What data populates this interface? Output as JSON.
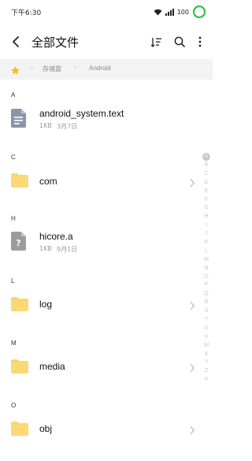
{
  "status_bar": {
    "time": "下午6:30",
    "battery": "100",
    "icons": [
      "wifi-icon",
      "signal-icon",
      "battery-ring-icon"
    ]
  },
  "app_bar": {
    "title": "全部文件",
    "actions": [
      "sort-icon",
      "search-icon",
      "more-vertical-icon"
    ]
  },
  "breadcrumb": {
    "items": [
      "存储盘",
      "Android"
    ]
  },
  "colors": {
    "accent": "#f5b91e",
    "folder": "#fbd46b",
    "file_icon": "#8a96a8",
    "unknown_icon": "#9c9c9c",
    "battery_ring": "#30c24a"
  },
  "sections": [
    {
      "letter": "A",
      "items": [
        {
          "name": "android_system.text",
          "size": "1KB",
          "date": "3月7日",
          "type": "document"
        }
      ]
    },
    {
      "letter": "C",
      "items": [
        {
          "name": "com",
          "type": "folder"
        }
      ]
    },
    {
      "letter": "H",
      "items": [
        {
          "name": "hicore.a",
          "size": "1KB",
          "date": "9月1日",
          "type": "unknown"
        }
      ]
    },
    {
      "letter": "L",
      "items": [
        {
          "name": "log",
          "type": "folder"
        }
      ]
    },
    {
      "letter": "M",
      "items": [
        {
          "name": "media",
          "type": "folder"
        }
      ]
    },
    {
      "letter": "O",
      "items": [
        {
          "name": "obj",
          "type": "folder"
        }
      ]
    }
  ],
  "alpha_index": [
    "A",
    "B",
    "C",
    "D",
    "E",
    "F",
    "G",
    "H",
    "I",
    "J",
    "K",
    "L",
    "M",
    "N",
    "O",
    "P",
    "Q",
    "R",
    "S",
    "T",
    "U",
    "V",
    "W",
    "X",
    "Y",
    "Z",
    "#"
  ]
}
